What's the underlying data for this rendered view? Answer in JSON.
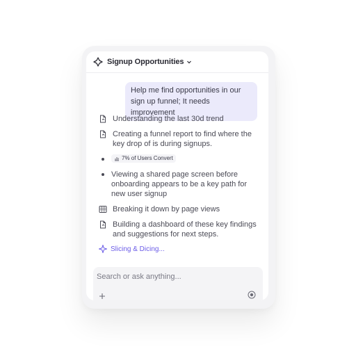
{
  "header": {
    "title": "Signup Opportunities",
    "logo_icon": "sparkle-diamond-icon",
    "dropdown_icon": "chevron-down-icon"
  },
  "user_message": "Help me find opportunities in our sign up funnel; It needs improvement",
  "steps": [
    {
      "type": "doc",
      "icon": "document-icon",
      "text": "Understanding the last 30d trend"
    },
    {
      "type": "doc",
      "icon": "document-icon",
      "text": "Creating a funnel report to find where the key drop of is during signups."
    },
    {
      "type": "badge",
      "icon": "bar-chart-icon",
      "text": "7% of Users Convert"
    },
    {
      "type": "bullet",
      "text": "Viewing a shared page screen before onboarding appears to be a key path for new user signup"
    },
    {
      "type": "table",
      "icon": "table-icon",
      "text": "Breaking it down by page views"
    },
    {
      "type": "doc",
      "icon": "document-icon",
      "text": "Building a dashboard of these key findings and suggestions for next steps."
    }
  ],
  "status": {
    "icon": "sparkle-icon",
    "text": "Slicing & Dicing..."
  },
  "composer": {
    "placeholder": "Search or ask anything...",
    "add_icon": "plus-icon",
    "send_icon": "stop-circle-icon"
  },
  "colors": {
    "accent": "#6b5ce7",
    "bubble": "#ebeafb",
    "composer_bg": "#f4f4f6"
  }
}
